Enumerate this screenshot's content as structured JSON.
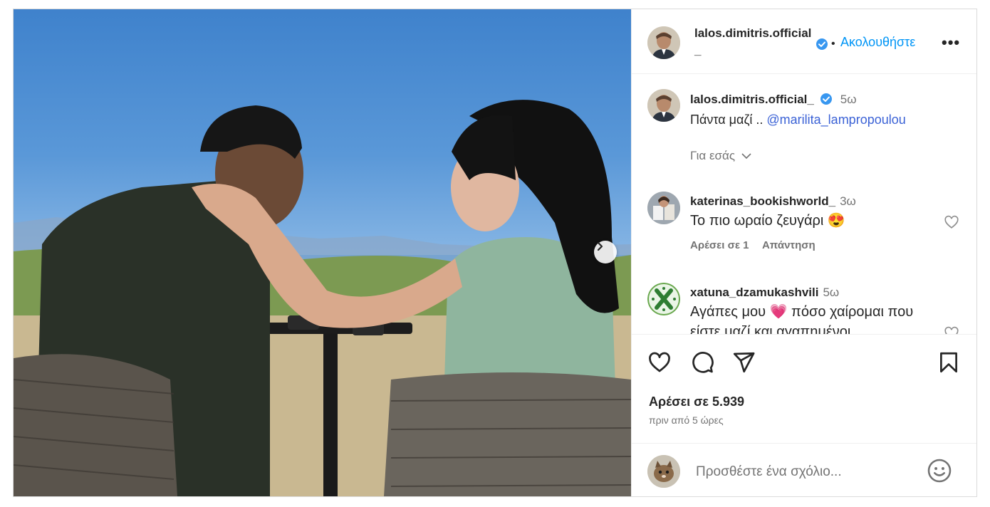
{
  "post": {
    "author": "lalos.dimitris.official_",
    "follow_label": "Ακολουθήστε",
    "more_label": "•••",
    "caption": {
      "username": "lalos.dimitris.official_",
      "time": "5ω",
      "text": "Πάντα μαζί .. ",
      "mention": "@marilita_lampropoulou"
    },
    "translation_label": "Για εσάς",
    "comments": [
      {
        "username": "katerinas_bookishworld_",
        "time": "3ω",
        "text": "Το πιο ωραίο ζευγάρι 😍",
        "likes_label": "Αρέσει σε 1",
        "reply_label": "Απάντηση"
      },
      {
        "username": "xatuna_dzamukashvili",
        "time": "5ω",
        "text": "Αγάπες μου 💗 πόσο χαίρομαι που είστε μαζί και αγαπημένοι"
      }
    ],
    "likes_text": "Αρέσει σε 5.939",
    "posted_time": "πριν από 5 ώρες",
    "add_comment_placeholder": "Προσθέστε ένα σχόλιο..."
  },
  "icons": {
    "verified": "verified-badge-icon",
    "like": "heart-icon",
    "comment": "comment-icon",
    "share": "send-icon",
    "save": "bookmark-icon",
    "emoji": "smiley-icon",
    "next": "chevron-right-icon"
  },
  "colors": {
    "link_blue": "#0095f6",
    "verified_blue": "#3897f0",
    "secondary_text": "#737373"
  }
}
